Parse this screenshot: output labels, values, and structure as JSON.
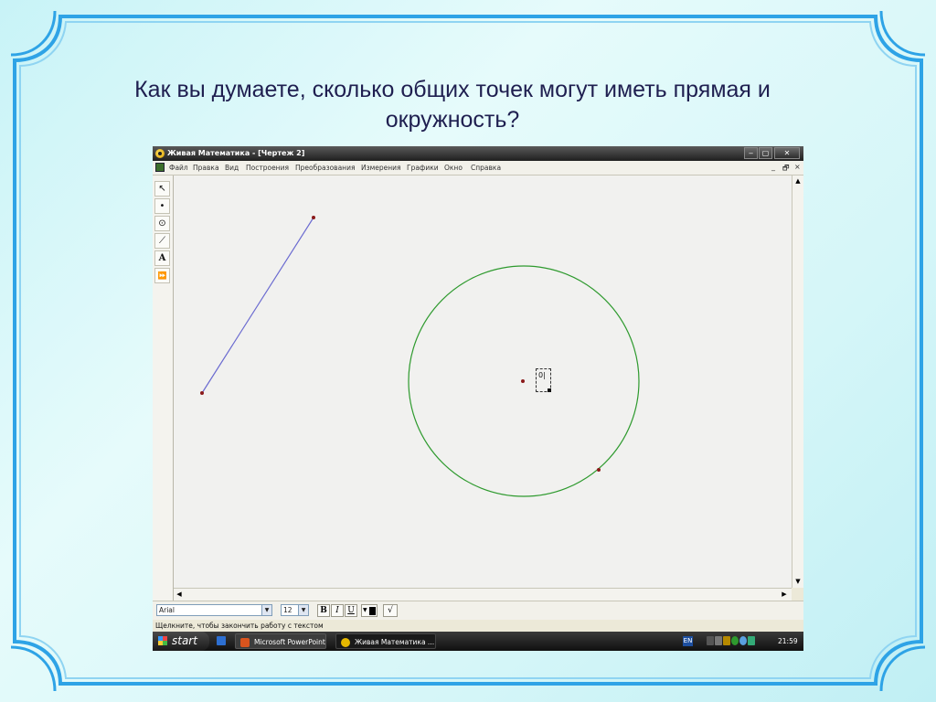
{
  "slide": {
    "title": "Как вы думаете, сколько общих точек могут иметь прямая и окружность?"
  },
  "window": {
    "title": "Живая Математика - [Чертеж 2]",
    "minimize_glyph": "‒",
    "maximize_glyph": "▢",
    "close_glyph": "✕"
  },
  "menu": {
    "items": [
      "Файл",
      "Правка",
      "Вид",
      "Построения",
      "Преобразования",
      "Измерения",
      "Графики",
      "Окно",
      "Справка"
    ],
    "doc_minimize": "_",
    "doc_restore": "🗗",
    "doc_close": "×"
  },
  "toolbox": {
    "tools": [
      {
        "name": "arrow-select-tool",
        "glyph": "↖"
      },
      {
        "name": "point-tool",
        "glyph": "•"
      },
      {
        "name": "compass-tool",
        "glyph": "⊙"
      },
      {
        "name": "straightedge-tool",
        "glyph": "⟋"
      },
      {
        "name": "text-tool",
        "glyph": "A"
      },
      {
        "name": "custom-tool",
        "glyph": "⏩"
      }
    ]
  },
  "canvas": {
    "label_text": "0|",
    "segment_color": "#6a6ad0",
    "circle_color": "#2e9a2e",
    "point_color": "#8b1a1a"
  },
  "format_bar": {
    "font_value": "Arial",
    "size_value": "12",
    "bold": "B",
    "italic": "I",
    "underline": "U",
    "math_glyph": "√"
  },
  "status": {
    "text": "Щелкните, чтобы закончить работу с текстом"
  },
  "taskbar": {
    "start_label": "start",
    "task1": "Microsoft PowerPoint ...",
    "task2": "Живая Математика ...",
    "lang": "EN",
    "clock": "21:59"
  },
  "colors": {
    "frame_blue": "#2ea3e6",
    "title_color": "#1f1f50"
  }
}
